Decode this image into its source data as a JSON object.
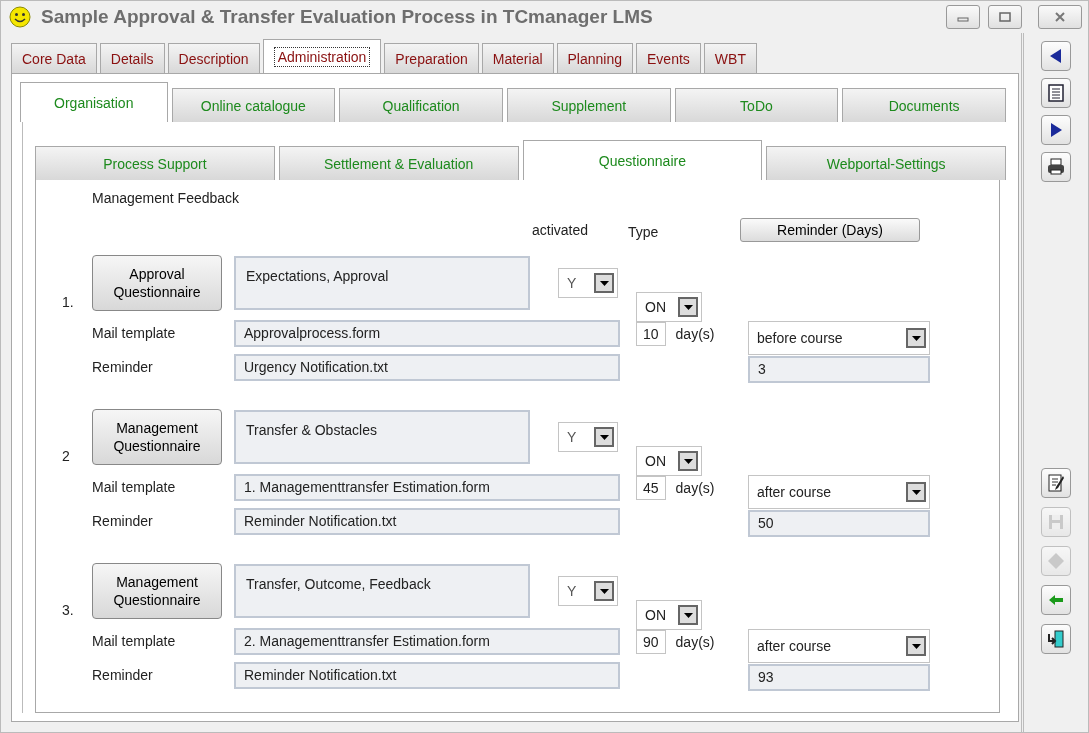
{
  "window": {
    "title": "Sample Approval & Transfer Evaluation Process in TCmanager LMS"
  },
  "main_tabs": [
    {
      "label": "Core Data",
      "selected": false
    },
    {
      "label": "Details",
      "selected": false
    },
    {
      "label": "Description",
      "selected": false
    },
    {
      "label": "Administration",
      "selected": true
    },
    {
      "label": "Preparation",
      "selected": false
    },
    {
      "label": "Material",
      "selected": false
    },
    {
      "label": "Planning",
      "selected": false
    },
    {
      "label": "Events",
      "selected": false
    },
    {
      "label": "WBT",
      "selected": false
    }
  ],
  "sub_tabs": [
    {
      "label": "Organisation",
      "selected": true
    },
    {
      "label": "Online catalogue",
      "selected": false
    },
    {
      "label": "Qualification",
      "selected": false
    },
    {
      "label": "Supplement",
      "selected": false
    },
    {
      "label": "ToDo",
      "selected": false
    },
    {
      "label": "Documents",
      "selected": false
    }
  ],
  "section_tabs": [
    {
      "label": "Process Support",
      "selected": false
    },
    {
      "label": "Settlement & Evaluation",
      "selected": false
    },
    {
      "label": "Questionnaire",
      "selected": true
    },
    {
      "label": "Webportal-Settings",
      "selected": false
    }
  ],
  "section_title": "Management  Feedback",
  "column_headers": {
    "activated": "activated",
    "type": "Type",
    "reminder_button": "Reminder (Days)"
  },
  "questionnaires": [
    {
      "number": "1.",
      "button": "Approval Questionnaire",
      "description": "Expectations, Approval",
      "activated": "Y",
      "type": "ON",
      "mail_template_label": "Mail template",
      "mail_template": "Approvalprocess.form",
      "reminder_label": "Reminder",
      "reminder": "Urgency Notification.txt",
      "days": "10",
      "days_unit": "day(s)",
      "timing": "before course",
      "reminder_days": "3"
    },
    {
      "number": "2",
      "button": "Management Questionnaire",
      "description": "Transfer & Obstacles",
      "activated": "Y",
      "type": "ON",
      "mail_template_label": "Mail template",
      "mail_template": "1. Managementtransfer Estimation.form",
      "reminder_label": "Reminder",
      "reminder": "Reminder Notification.txt",
      "days": "45",
      "days_unit": "day(s)",
      "timing": "after course",
      "reminder_days": "50"
    },
    {
      "number": "3.",
      "button": "Management Questionnaire",
      "description": "Transfer, Outcome, Feedback",
      "activated": "Y",
      "type": "ON",
      "mail_template_label": "Mail template",
      "mail_template": "2. Managementtransfer Estimation.form",
      "reminder_label": "Reminder",
      "reminder": "Reminder Notification.txt",
      "days": "90",
      "days_unit": "day(s)",
      "timing": "after course",
      "reminder_days": "93"
    }
  ],
  "toolbar_top": [
    {
      "kind": "back",
      "disabled": false
    },
    {
      "kind": "list",
      "disabled": false
    },
    {
      "kind": "forward",
      "disabled": false
    },
    {
      "kind": "print",
      "disabled": false
    }
  ],
  "toolbar_bottom": [
    {
      "kind": "edit",
      "disabled": false
    },
    {
      "kind": "save",
      "disabled": true
    },
    {
      "kind": "erase",
      "disabled": true
    },
    {
      "kind": "import_arrow",
      "disabled": false
    },
    {
      "kind": "exit",
      "disabled": false
    }
  ]
}
